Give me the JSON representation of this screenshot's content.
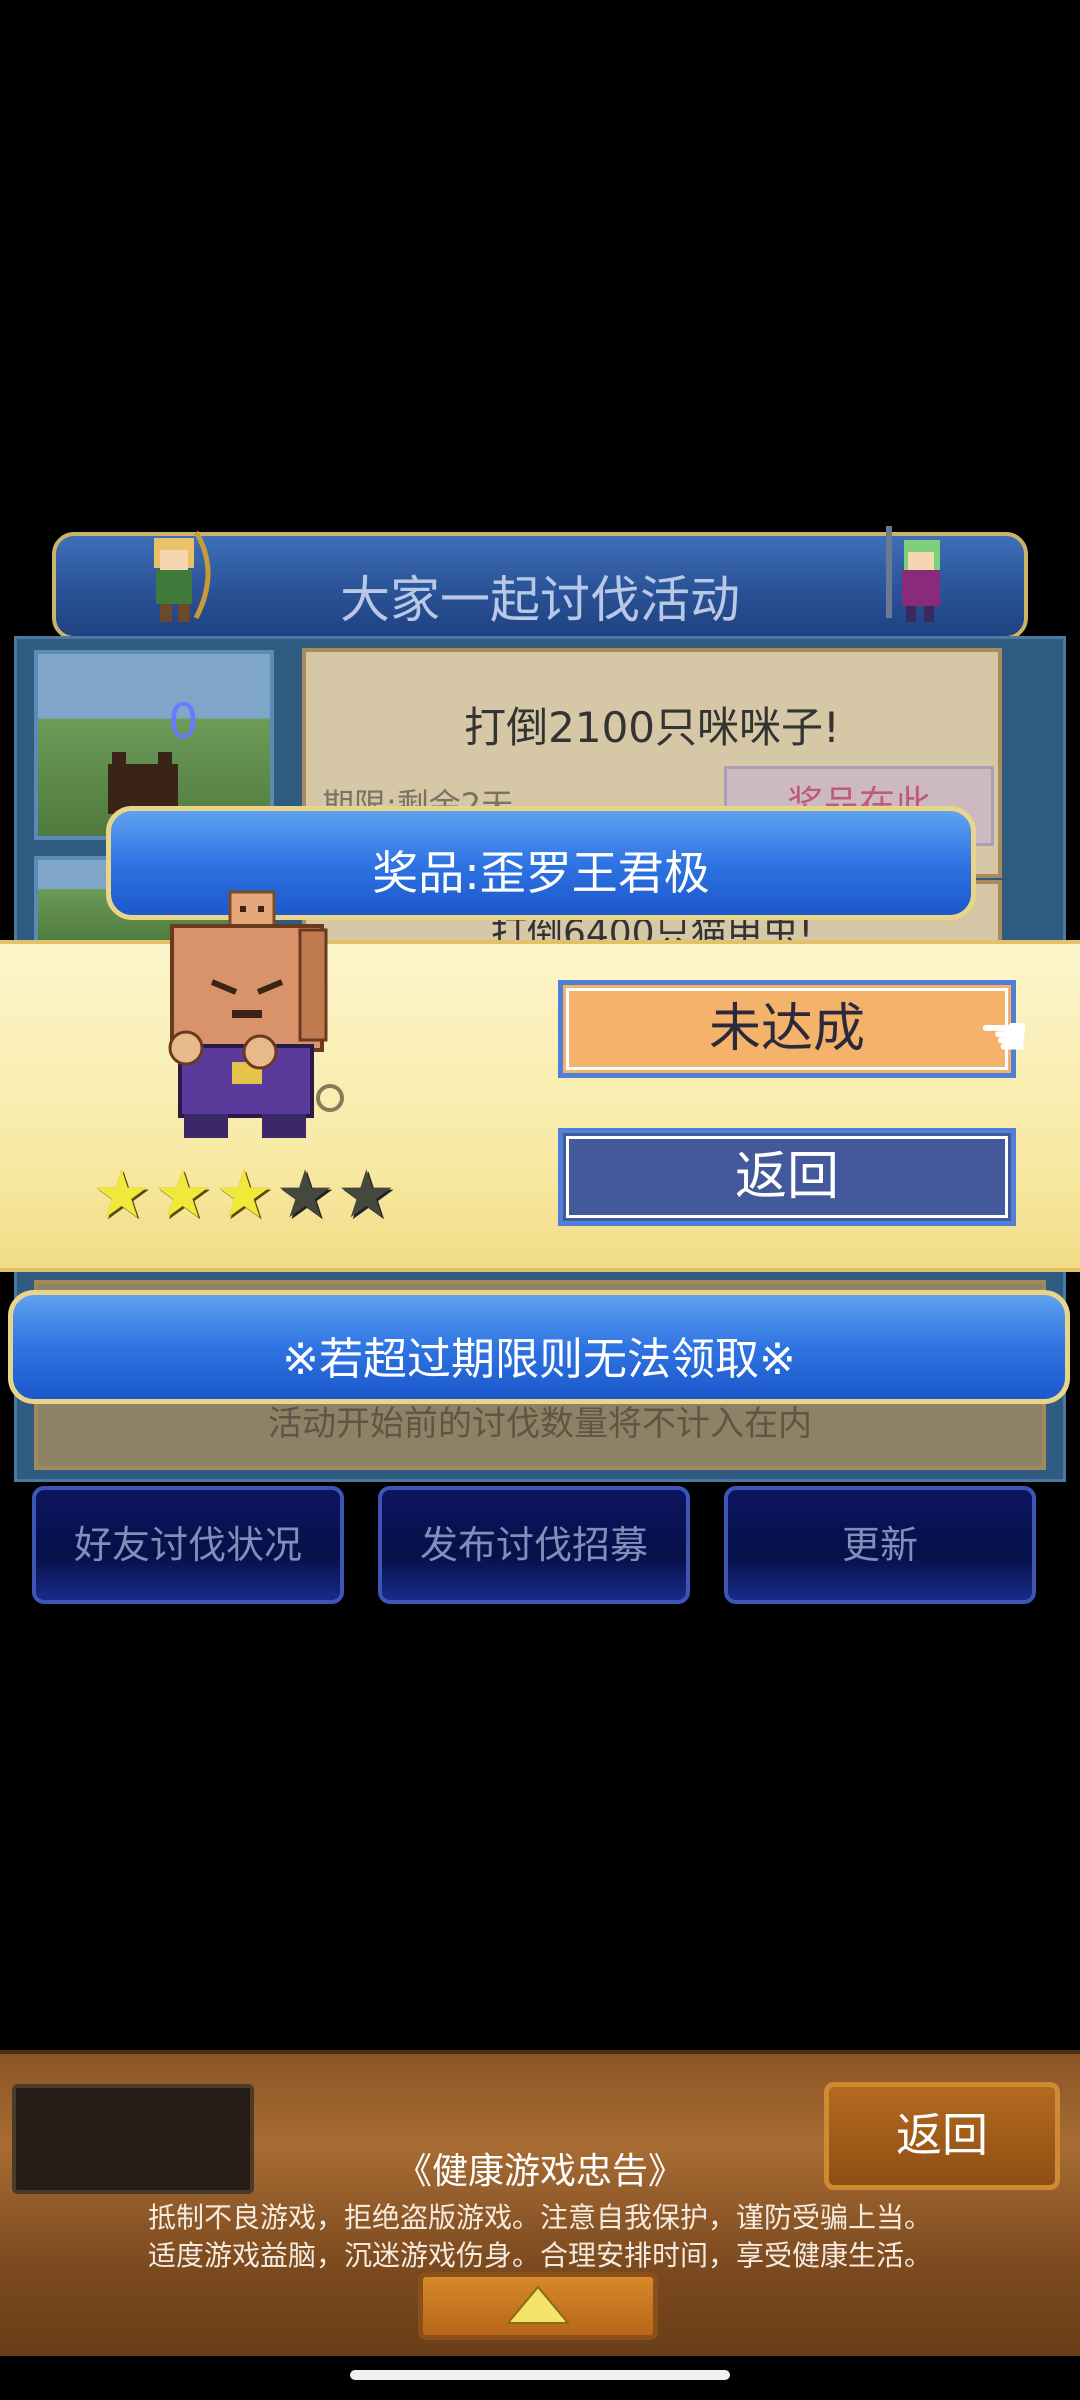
{
  "event": {
    "title": "大家一起讨伐活动",
    "task1": "打倒2100只咪咪子!",
    "deadline": "期限:剩余2天",
    "reward_btn": "奖品在此",
    "task2": "打倒6400只猫甲虫!",
    "info_note": "活动开始前的讨伐数量将不计入在内"
  },
  "bottom_buttons": [
    "好友讨伐状况",
    "发布讨伐招募",
    "更新"
  ],
  "modal": {
    "prize_title": "奖品:歪罗王君极",
    "button_unachieved": "未达成",
    "button_back": "返回",
    "notice": "※若超过期限则无法领取※",
    "stars_filled": 3,
    "stars_total": 5,
    "thumb_counter": "0"
  },
  "health_bar": {
    "back_button": "返回",
    "title": "《健康游戏忠告》",
    "line1": "抵制不良游戏，拒绝盗版游戏。注意自我保护，谨防受骗上当。",
    "line2": "适度游戏益脑，沉迷游戏伤身。合理安排时间，享受健康生活。"
  },
  "colors": {
    "banner_blue": "#2f74e2",
    "modal_yellow": "#fdf5cc",
    "button_orange": "#f4b26a",
    "button_blue": "#44589c"
  }
}
